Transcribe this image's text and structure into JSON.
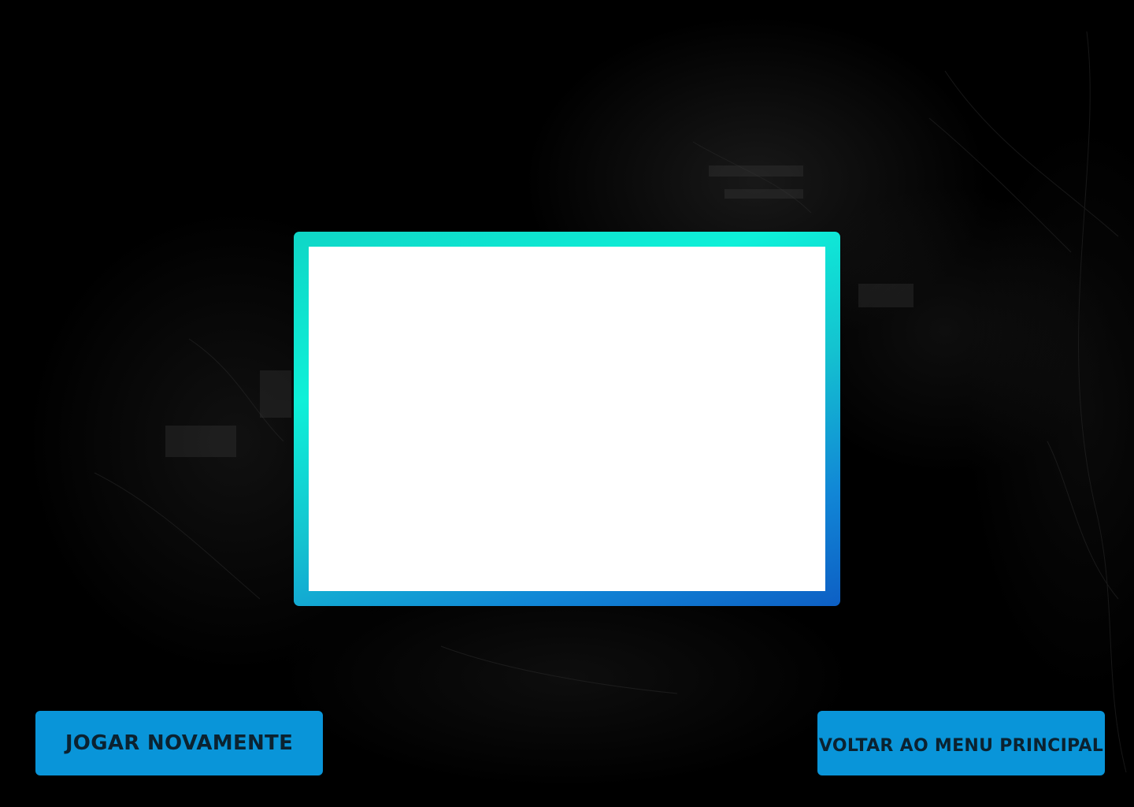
{
  "buttons": {
    "play_again": "JOGAR NOVAMENTE",
    "main_menu": "VOLTAR AO MENU PRINCIPAL"
  },
  "colors": {
    "background": "#000000",
    "frame_gradient_start": "#0ef0d8",
    "frame_gradient_end": "#0d5fc4",
    "panel": "#ffffff",
    "button": "#0995d9",
    "button_text": "#0b2230"
  }
}
